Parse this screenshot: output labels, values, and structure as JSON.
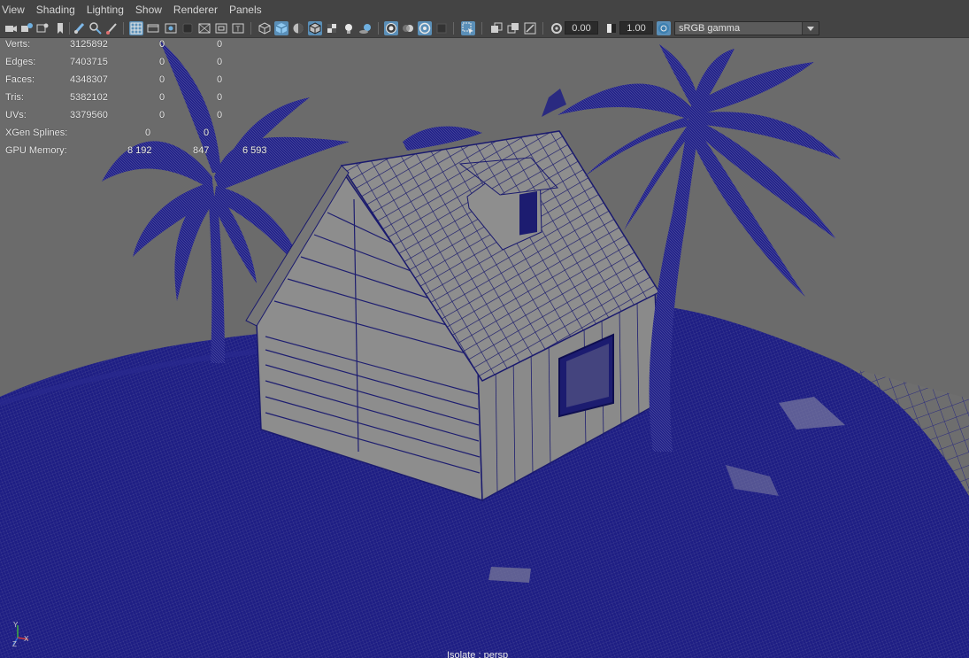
{
  "menu": [
    "View",
    "Shading",
    "Lighting",
    "Show",
    "Renderer",
    "Panels"
  ],
  "toolbar": {
    "exposure": "0.00",
    "gamma": "1.00",
    "color_space": "sRGB gamma",
    "icons": [
      "camera-icon",
      "camera-attributes-icon",
      "image-plane-icon",
      "bookmark-icon",
      "grease-pencil-icon",
      "2d-pan-zoom-icon",
      "brush-icon",
      "grid-icon",
      "film-gate-icon",
      "resolution-gate-icon",
      "gate-mask-icon",
      "field-chart-icon",
      "safe-action-icon",
      "safe-title-icon",
      "wireframe-icon",
      "smooth-shade-icon",
      "default-lighting-icon",
      "wireframe-on-shaded-icon",
      "textured-icon",
      "lights-icon",
      "shadows-icon",
      "screen-space-ao-icon",
      "motion-blur-icon",
      "anti-aliasing-icon",
      "depth-of-field-icon",
      "isolate-select-icon",
      "xray-icon",
      "xray-active-icon",
      "xray-joints-icon",
      "exposure-icon",
      "gamma-icon",
      "color-management-icon"
    ]
  },
  "hud": {
    "rows": [
      {
        "label": "Verts:",
        "v1": "3125892",
        "v2": "0",
        "v3": "0"
      },
      {
        "label": "Edges:",
        "v1": "7403715",
        "v2": "0",
        "v3": "0"
      },
      {
        "label": "Faces:",
        "v1": "4348307",
        "v2": "0",
        "v3": "0"
      },
      {
        "label": "Tris:",
        "v1": "5382102",
        "v2": "0",
        "v3": "0"
      },
      {
        "label": "UVs:",
        "v1": "3379560",
        "v2": "0",
        "v3": "0"
      }
    ],
    "xgen": {
      "label": "XGen Splines:",
      "v1": "0",
      "v2": "0"
    },
    "gpu": {
      "label": "GPU Memory:",
      "v1": "8 192",
      "v2": "847",
      "v3": "6 593"
    }
  },
  "axis": {
    "y": "Y",
    "x": "X",
    "z": "Z"
  },
  "footer": {
    "label": "Isolate : persp"
  },
  "colors": {
    "wire": "#1a1a7a",
    "wire_dense": "#15157a",
    "background": "#6b6b6b",
    "house": "#8a8a8a",
    "ui_bar": "#444444",
    "ui_active": "#5a8fb8"
  }
}
